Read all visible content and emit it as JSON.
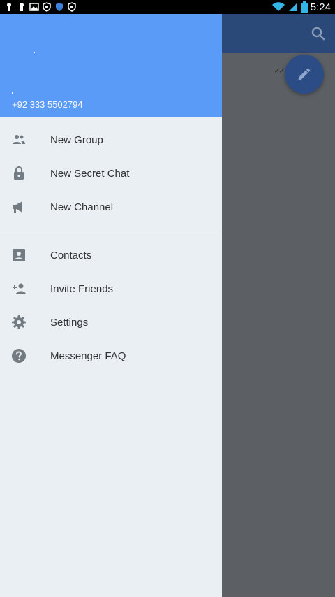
{
  "status_bar": {
    "time": "5:24",
    "left_icons": [
      "usb-icon",
      "usb-icon",
      "image-icon",
      "shield-icon",
      "shield-icon",
      "shield-icon"
    ],
    "right_icons": [
      "wifi-icon",
      "signal-icon",
      "battery-icon"
    ]
  },
  "drawer": {
    "header": {
      "phone": "+92 333 5502794",
      "color": "#5b9bf8"
    },
    "menu_group_1": [
      {
        "label": "New Group",
        "icon": "group-icon"
      },
      {
        "label": "New Secret Chat",
        "icon": "lock-icon"
      },
      {
        "label": "New Channel",
        "icon": "megaphone-icon"
      }
    ],
    "menu_group_2": [
      {
        "label": "Contacts",
        "icon": "contacts-icon"
      },
      {
        "label": "Invite Friends",
        "icon": "add-person-icon"
      },
      {
        "label": "Settings",
        "icon": "gear-icon"
      },
      {
        "label": "Messenger FAQ",
        "icon": "help-icon"
      }
    ]
  },
  "background_app": {
    "toolbar_color": "#2a4878",
    "fab_icon": "pencil-icon",
    "search_icon": "search-icon"
  }
}
